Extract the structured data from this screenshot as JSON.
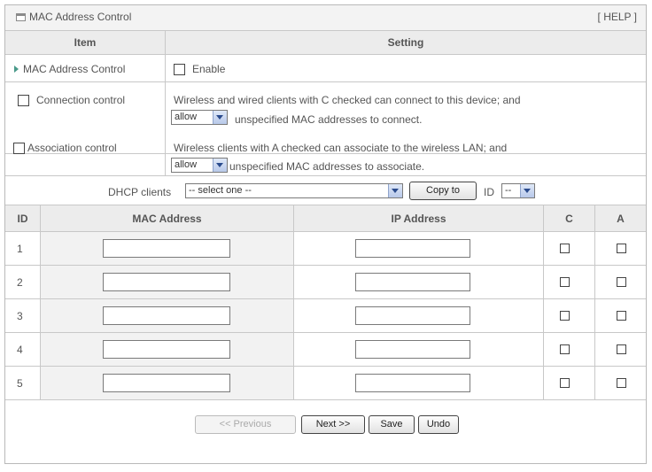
{
  "panel": {
    "title": "MAC Address Control",
    "help": "[ HELP ]"
  },
  "header": {
    "item": "Item",
    "setting": "Setting"
  },
  "mac_control": {
    "label": "MAC Address Control",
    "enable_label": "Enable"
  },
  "connection": {
    "label": "Connection control",
    "line1": "Wireless and wired clients with C checked can connect to this device; and",
    "select_value": "allow",
    "line2": "unspecified MAC addresses to connect."
  },
  "association": {
    "label": "Association control",
    "line1": "Wireless clients with A checked can associate to the wireless LAN; and",
    "select_value": "allow",
    "line2": "unspecified MAC addresses to associate."
  },
  "dhcp": {
    "label": "DHCP clients",
    "select_value": "-- select one --",
    "copy_button": "Copy to",
    "id_label": "ID",
    "id_value": "--"
  },
  "table": {
    "columns": [
      "ID",
      "MAC Address",
      "IP Address",
      "C",
      "A"
    ],
    "rows": [
      {
        "id": "1"
      },
      {
        "id": "2"
      },
      {
        "id": "3"
      },
      {
        "id": "4"
      },
      {
        "id": "5"
      }
    ]
  },
  "footer": {
    "previous": "<< Previous",
    "next": "Next >>",
    "save": "Save",
    "undo": "Undo"
  },
  "colors": {
    "border": "#c8c8c8",
    "header_bg": "#ececec",
    "arrow": "#4a9a8a"
  }
}
